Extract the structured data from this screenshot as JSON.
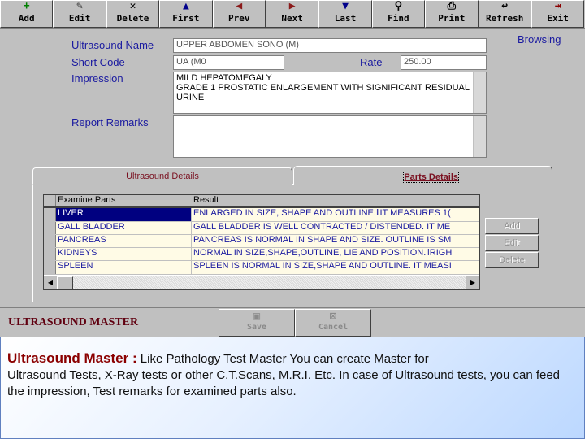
{
  "toolbar": [
    {
      "label": "Add",
      "icon": "plus-icon",
      "glyph": "+",
      "color": "#008000"
    },
    {
      "label": "Edit",
      "icon": "edit-icon",
      "glyph": "✎",
      "color": "#333"
    },
    {
      "label": "Delete",
      "icon": "delete-icon",
      "glyph": "✕",
      "color": "#000"
    },
    {
      "label": "First",
      "icon": "arrow-up-icon",
      "glyph": "▲",
      "color": "#00008b"
    },
    {
      "label": "Prev",
      "icon": "arrow-left-icon",
      "glyph": "◀",
      "color": "#8b1a1a"
    },
    {
      "label": "Next",
      "icon": "arrow-right-icon",
      "glyph": "▶",
      "color": "#8b1a1a"
    },
    {
      "label": "Last",
      "icon": "arrow-down-icon",
      "glyph": "▼",
      "color": "#00008b"
    },
    {
      "label": "Find",
      "icon": "binoculars-icon",
      "glyph": "⚲",
      "color": "#000"
    },
    {
      "label": "Print",
      "icon": "printer-icon",
      "glyph": "⎙",
      "color": "#000"
    },
    {
      "label": "Refresh",
      "icon": "refresh-icon",
      "glyph": "↩",
      "color": "#000"
    },
    {
      "label": "Exit",
      "icon": "exit-icon",
      "glyph": "⇥",
      "color": "#8b0000"
    }
  ],
  "mode": "Browsing",
  "form": {
    "name_label": "Ultrasound Name",
    "name": "UPPER ABDOMEN SONO (M)",
    "code_label": "Short Code",
    "code": "UA (M0",
    "rate_label": "Rate",
    "rate": "250.00",
    "impression_label": "Impression",
    "impression": "MILD HEPATOMEGALY\nGRADE 1 PROSTATIC ENLARGEMENT WITH SIGNIFICANT RESIDUAL URINE",
    "remarks_label": "Report Remarks",
    "remarks": ""
  },
  "tabs": [
    "Ultrasound Details",
    "Parts Details"
  ],
  "grid": {
    "columns": [
      "Examine Parts",
      "Result"
    ],
    "rows": [
      [
        "LIVER",
        "ENLARGED IN SIZE, SHAPE AND OUTLINE.‖IT MEASURES 1("
      ],
      [
        "GALL BLADDER",
        "GALL BLADDER IS WELL CONTRACTED / DISTENDED. IT ME"
      ],
      [
        "PANCREAS",
        "PANCREAS IS NORMAL IN SHAPE AND SIZE. OUTLINE IS SM"
      ],
      [
        "KIDNEYS",
        "NORMAL IN SIZE,SHAPE,OUTLINE, LIE AND POSITION.‖RIGH"
      ],
      [
        "SPLEEN",
        "SPLEEN IS NORMAL IN SIZE,SHAPE AND OUTLINE. IT MEASI"
      ]
    ]
  },
  "side_buttons": [
    "Add",
    "Edit",
    "Delete"
  ],
  "status": {
    "title": "ULTRASOUND MASTER",
    "save": "Save",
    "cancel": "Cancel"
  },
  "desc": {
    "heading": "Ultrasound Master :",
    "text1": " Like Pathology Test Master You can create Master for",
    "text2": "Ultrasound Tests, X-Ray tests or other C.T.Scans, M.R.I. Etc. In case of Ultrasound tests, you can feed the impression, Test remarks for examined parts also."
  }
}
